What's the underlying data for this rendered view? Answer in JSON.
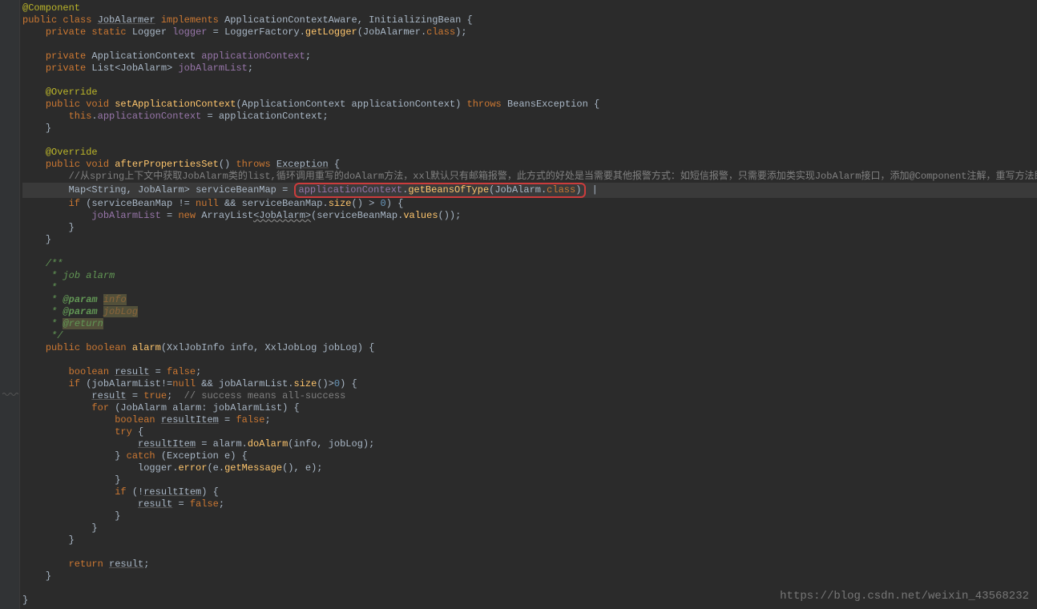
{
  "code": {
    "l1": {
      "anno": "@Component"
    },
    "l2": {
      "kw1": "public class ",
      "cls": "JobAlarmer",
      "kw2": " implements ",
      "impl": "ApplicationContextAware, InitializingBean {"
    },
    "l3": {
      "kw": "private static ",
      "type": "Logger ",
      "var": "logger",
      "eq": " = ",
      "call": "LoggerFactory.",
      "m": "getLogger",
      "arg": "(JobAlarmer.",
      "kw2": "class",
      "end": ");"
    },
    "l4": "",
    "l5": {
      "kw": "private ",
      "type": "ApplicationContext ",
      "var": "applicationContext",
      "end": ";"
    },
    "l6": {
      "kw": "private ",
      "type": "List",
      "gen": "<JobAlarm>",
      "var": " jobAlarmList",
      "end": ";"
    },
    "l7": "",
    "l8": {
      "anno": "@Override"
    },
    "l9": {
      "kw": "public void ",
      "m": "setApplicationContext",
      "p1": "(",
      "type": "ApplicationContext ",
      "arg": "applicationContext) ",
      "kw2": "throws ",
      "exc": "BeansException {"
    },
    "l10": {
      "kw": "this",
      "dot": ".",
      "f": "applicationContext",
      "eq": " = applicationContext;"
    },
    "l11": "}",
    "l12": "",
    "l13": {
      "anno": "@Override"
    },
    "l14": {
      "kw": "public void ",
      "m": "afterPropertiesSet",
      "p": "() ",
      "kw2": "throws ",
      "exc": "Exception",
      "brace": " {"
    },
    "l15": {
      "cmt": "//从spring上下文中获取JobAlarm类的list,循环调用重写的doAlarm方法，xxl默认只有邮箱报警，此方式的好处是当需要其他报警方式：如短信报警，只需要添加类实现JobAlarm接口，添加@Component注解，重写方法即可。"
    },
    "l16": {
      "type1": "Map",
      "ang1": "<",
      "type2": "String",
      "comma": ", ",
      "type3": "JobAlarm",
      "ang2": "> ",
      "var": "serviceBeanMap",
      "eq": " = ",
      "obj": "applicationContext",
      "dot": ".",
      "m": "getBeansOfType",
      "p1": "(",
      "arg": "JobAlarm",
      "dot2": ".",
      "kw": "class",
      "p2": ")",
      "cursor": " |"
    },
    "l17": {
      "kw": "if ",
      "p": "(serviceBeanMap != ",
      "null": "null",
      "and": " && ",
      "obj": "serviceBeanMap.",
      "m": "size",
      "call": "() > ",
      "num": "0",
      "end": ") {"
    },
    "l18": {
      "f": "jobAlarmList",
      "eq": " = ",
      "kw": "new ",
      "type": "ArrayList",
      "gen": "<JobAlarm>",
      "p": "(serviceBeanMap.",
      "m": "values",
      "end": "());"
    },
    "l19": "}",
    "l20": "}",
    "l21": "",
    "l22": "/**",
    "l23": " * job alarm",
    "l24": " *",
    "l25": {
      "pre": " * ",
      "tag": "@param ",
      "p": "info"
    },
    "l26": {
      "pre": " * ",
      "tag": "@param ",
      "p": "jobLog"
    },
    "l27": {
      "pre": " * ",
      "tag": "@return"
    },
    "l28": " */",
    "l29": {
      "kw": "public boolean ",
      "m": "alarm",
      "p": "(XxlJobInfo info, XxlJobLog jobLog) {"
    },
    "l30": "",
    "l31": {
      "kw": "boolean ",
      "var": "result",
      "eq": " = ",
      "val": "false",
      "end": ";"
    },
    "l32": {
      "kw": "if ",
      "p": "(jobAlarmList!=",
      "null": "null",
      "and": " && ",
      "obj": "jobAlarmList.",
      "m": "size",
      "call": "()>",
      "num": "0",
      "end": ") {"
    },
    "l33": {
      "var": "result",
      "eq": " = ",
      "val": "true",
      "end": ";",
      "cmt": "  // success means all-success"
    },
    "l34": {
      "kw": "for ",
      "p": "(JobAlarm alarm: jobAlarmList) {"
    },
    "l35": {
      "kw": "boolean ",
      "var": "resultItem",
      "eq": " = ",
      "val": "false",
      "end": ";"
    },
    "l36": {
      "kw": "try ",
      "brace": "{"
    },
    "l37": {
      "var": "resultItem",
      "eq": " = alarm.",
      "m": "doAlarm",
      "p": "(info, jobLog);"
    },
    "l38": {
      "brace": "} ",
      "kw": "catch ",
      "p": "(Exception e) {"
    },
    "l39": {
      "obj": "logger.",
      "m": "error",
      "p": "(e.",
      "m2": "getMessage",
      "p2": "(), e);"
    },
    "l40": "}",
    "l41": {
      "kw": "if ",
      "p": "(!",
      "var": "resultItem",
      "end": ") {"
    },
    "l42": {
      "var": "result",
      "eq": " = ",
      "val": "false",
      "end": ";"
    },
    "l43": "}",
    "l44": "}",
    "l45": "}",
    "l46": "",
    "l47": {
      "kw": "return ",
      "var": "result",
      "end": ";"
    },
    "l48": "}",
    "l49": "",
    "l50": "}"
  },
  "watermark": "https://blog.csdn.net/weixin_43568232"
}
